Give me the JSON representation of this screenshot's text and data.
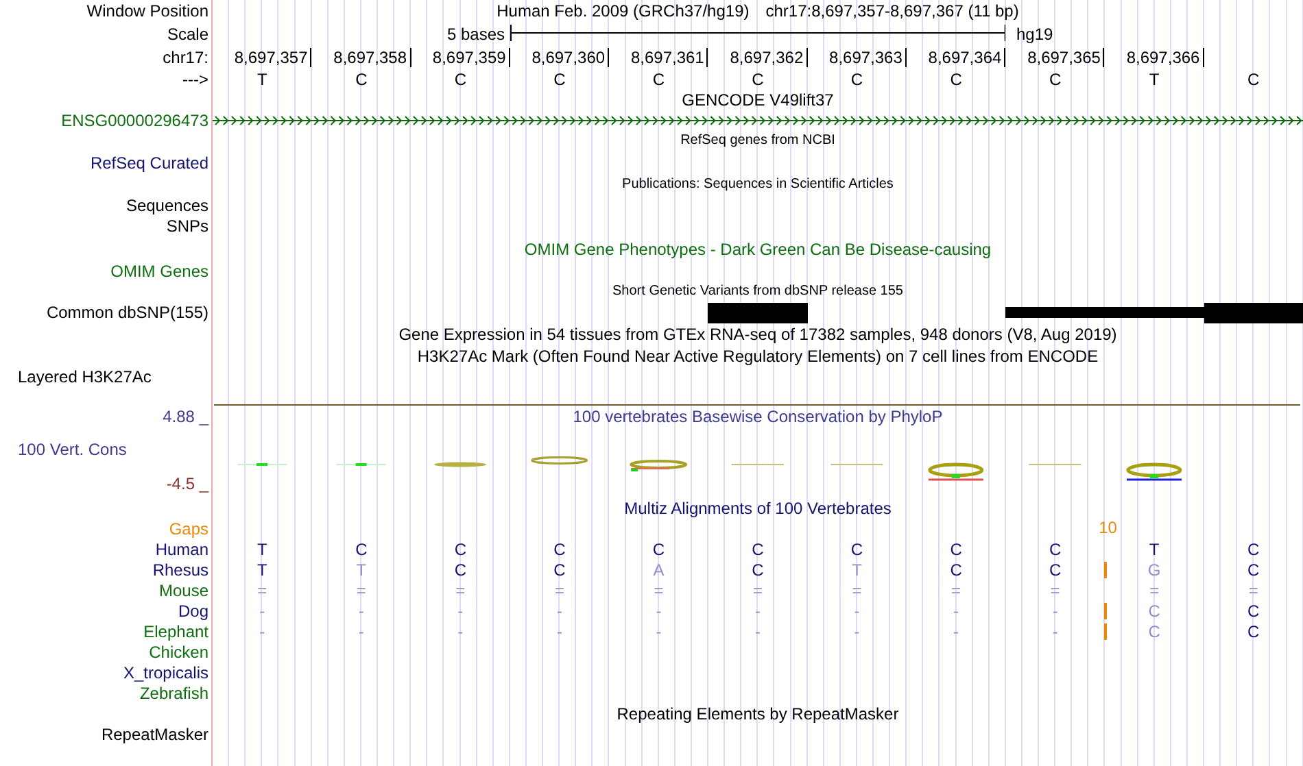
{
  "header": {
    "position_label": "Window Position",
    "assembly_title": "Human Feb. 2009 (GRCh37/hg19)",
    "range": "chr17:8,697,357-8,697,367 (11 bp)",
    "scale_label": "Scale",
    "scale_text": "5 bases",
    "scale_db": "hg19",
    "chrom_label": "chr17:",
    "positions": [
      "8,697,357",
      "8,697,358",
      "8,697,359",
      "8,697,360",
      "8,697,361",
      "8,697,362",
      "8,697,363",
      "8,697,364",
      "8,697,365",
      "8,697,366"
    ],
    "strand_label": "--->",
    "bases": [
      "T",
      "C",
      "C",
      "C",
      "C",
      "C",
      "C",
      "C",
      "C",
      "T",
      "C"
    ]
  },
  "tracks": {
    "gencode": {
      "title": "GENCODE V49lift37",
      "label": "ENSG00000296473"
    },
    "refseq": {
      "title": "RefSeq genes from NCBI",
      "label": "RefSeq Curated"
    },
    "publications": {
      "title": "Publications: Sequences in Scientific Articles",
      "label": "Sequences"
    },
    "snps": {
      "label": "SNPs"
    },
    "omim": {
      "title": "OMIM Gene Phenotypes - Dark Green Can Be Disease-causing",
      "label": "OMIM Genes"
    },
    "dbsnp": {
      "title": "Short Genetic Variants from dbSNP release 155",
      "label": "Common dbSNP(155)",
      "cells": [
        {
          "covered": false,
          "thick": false
        },
        {
          "covered": false,
          "thick": false
        },
        {
          "covered": false,
          "thick": false
        },
        {
          "covered": false,
          "thick": false
        },
        {
          "covered": false,
          "thick": false
        },
        {
          "covered": true,
          "thick": true
        },
        {
          "covered": false,
          "thick": false
        },
        {
          "covered": false,
          "thick": false
        },
        {
          "covered": true,
          "thick": false
        },
        {
          "covered": true,
          "thick": false
        },
        {
          "covered": true,
          "thick": true
        }
      ]
    },
    "gtex": {
      "title": "Gene Expression in 54 tissues from GTEx RNA-seq of 17382 samples, 948 donors (V8, Aug 2019)"
    },
    "h3k27ac": {
      "title": "H3K27Ac Mark (Often Found Near Active Regulatory Elements) on 7 cell lines from ENCODE",
      "label": "Layered H3K27Ac"
    },
    "phylop": {
      "title": "100 vertebrates Basewise Conservation by PhyloP",
      "label": "100 Vert. Cons",
      "max": "4.88 _",
      "min": "-4.5 _"
    },
    "multiz": {
      "title": "Multiz Alignments of 100 Vertebrates",
      "gaps_label": "Gaps",
      "gap_count": "10",
      "species": [
        {
          "name": "Human",
          "color": "#141470",
          "bases": [
            {
              "base": "T",
              "match": true
            },
            {
              "base": "C",
              "match": true
            },
            {
              "base": "C",
              "match": true
            },
            {
              "base": "C",
              "match": true
            },
            {
              "base": "C",
              "match": true
            },
            {
              "base": "C",
              "match": true
            },
            {
              "base": "C",
              "match": true
            },
            {
              "base": "C",
              "match": true
            },
            {
              "base": "C",
              "match": true
            },
            {
              "base": "T",
              "match": true
            },
            {
              "base": "C",
              "match": true
            }
          ]
        },
        {
          "name": "Rhesus",
          "color": "#141470",
          "bases": [
            {
              "base": "T",
              "match": true
            },
            {
              "base": "T",
              "match": false
            },
            {
              "base": "C",
              "match": true
            },
            {
              "base": "C",
              "match": true
            },
            {
              "base": "A",
              "match": false
            },
            {
              "base": "C",
              "match": true
            },
            {
              "base": "T",
              "match": false
            },
            {
              "base": "C",
              "match": true
            },
            {
              "base": "C",
              "match": true,
              "insert_after": true
            },
            {
              "base": "G",
              "match": false
            },
            {
              "base": "C",
              "match": true
            }
          ]
        },
        {
          "name": "Mouse",
          "color": "#0f6e0f",
          "bases": [
            {
              "base": "=",
              "match": false
            },
            {
              "base": "=",
              "match": false
            },
            {
              "base": "=",
              "match": false
            },
            {
              "base": "=",
              "match": false
            },
            {
              "base": "=",
              "match": false
            },
            {
              "base": "=",
              "match": false
            },
            {
              "base": "=",
              "match": false
            },
            {
              "base": "=",
              "match": false
            },
            {
              "base": "=",
              "match": false
            },
            {
              "base": "=",
              "match": false
            },
            {
              "base": "=",
              "match": false
            }
          ]
        },
        {
          "name": "Dog",
          "color": "#141470",
          "bases": [
            {
              "base": "-",
              "match": false
            },
            {
              "base": "-",
              "match": false
            },
            {
              "base": "-",
              "match": false
            },
            {
              "base": "-",
              "match": false
            },
            {
              "base": "-",
              "match": false
            },
            {
              "base": "-",
              "match": false
            },
            {
              "base": "-",
              "match": false
            },
            {
              "base": "-",
              "match": false
            },
            {
              "base": "-",
              "match": false,
              "insert_after": true
            },
            {
              "base": "C",
              "match": false
            },
            {
              "base": "C",
              "match": true
            }
          ]
        },
        {
          "name": "Elephant",
          "color": "#0f6e0f",
          "bases": [
            {
              "base": "-",
              "match": false
            },
            {
              "base": "-",
              "match": false
            },
            {
              "base": "-",
              "match": false
            },
            {
              "base": "-",
              "match": false
            },
            {
              "base": "-",
              "match": false
            },
            {
              "base": "-",
              "match": false
            },
            {
              "base": "-",
              "match": false
            },
            {
              "base": "-",
              "match": false
            },
            {
              "base": "-",
              "match": false,
              "insert_after": true
            },
            {
              "base": "C",
              "match": false
            },
            {
              "base": "C",
              "match": true
            }
          ]
        },
        {
          "name": "Chicken",
          "color": "#0f6e0f"
        },
        {
          "name": "X_tropicalis",
          "color": "#141470"
        },
        {
          "name": "Zebrafish",
          "color": "#0f6e0f"
        }
      ]
    },
    "repeatmasker": {
      "title": "Repeating Elements by RepeatMasker",
      "label": "RepeatMasker"
    }
  }
}
